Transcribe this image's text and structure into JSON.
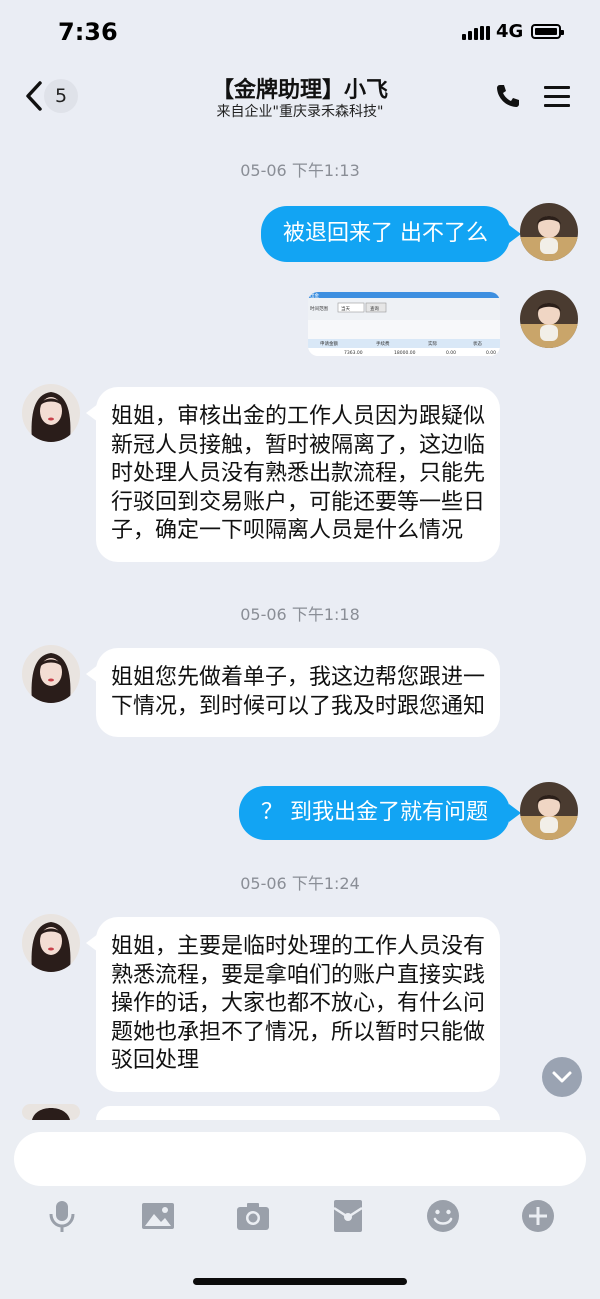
{
  "status_bar": {
    "time": "7:36",
    "network": "4G"
  },
  "nav": {
    "back_count": "5",
    "title": "【金牌助理】小飞",
    "subtitle": "来自企业\"重庆录禾森科技\""
  },
  "messages": [
    {
      "type": "timestamp",
      "text": "05-06 下午1:13"
    },
    {
      "type": "outgoing",
      "text": "被退回来了 出不了么"
    },
    {
      "type": "outgoing-image"
    },
    {
      "type": "incoming",
      "text": "姐姐，审核出金的工作人员因为跟疑似新冠人员接触，暂时被隔离了，这边临时处理人员没有熟悉出款流程，只能先行驳回到交易账户，可能还要等一些日子，确定一下呗隔离人员是什么情况"
    },
    {
      "type": "timestamp",
      "text": "05-06 下午1:18"
    },
    {
      "type": "incoming",
      "text": "姐姐您先做着单子，我这边帮您跟进一下情况，到时候可以了我及时跟您通知"
    },
    {
      "type": "outgoing",
      "text": "？ 到我出金了就有问题"
    },
    {
      "type": "timestamp",
      "text": "05-06 下午1:24"
    },
    {
      "type": "incoming",
      "text": "姐姐，主要是临时处理的工作人员没有熟悉流程，要是拿咱们的账户直接实践操作的话，大家也都不放心，有什么问题她也承担不了情况，所以暂时只能做驳回处理"
    }
  ],
  "screenshot_thumb": {
    "title": "出金",
    "filter_label": "时间范围",
    "filter_value": "当天",
    "query_button": "查询",
    "headers": [
      "申请金额",
      "手续费",
      "实际",
      "状态"
    ],
    "row": [
      "7363.00",
      "18000.00",
      "0.00",
      "0.00"
    ]
  },
  "input": {
    "value": "",
    "placeholder": ""
  },
  "toolbar": [
    "mic-icon",
    "image-icon",
    "camera-icon",
    "redpacket-icon",
    "emoji-icon",
    "plus-icon"
  ],
  "colors": {
    "outgoing_bubble": "#12a4f3",
    "background": "#eaedf4",
    "incoming_bubble": "#ffffff"
  }
}
